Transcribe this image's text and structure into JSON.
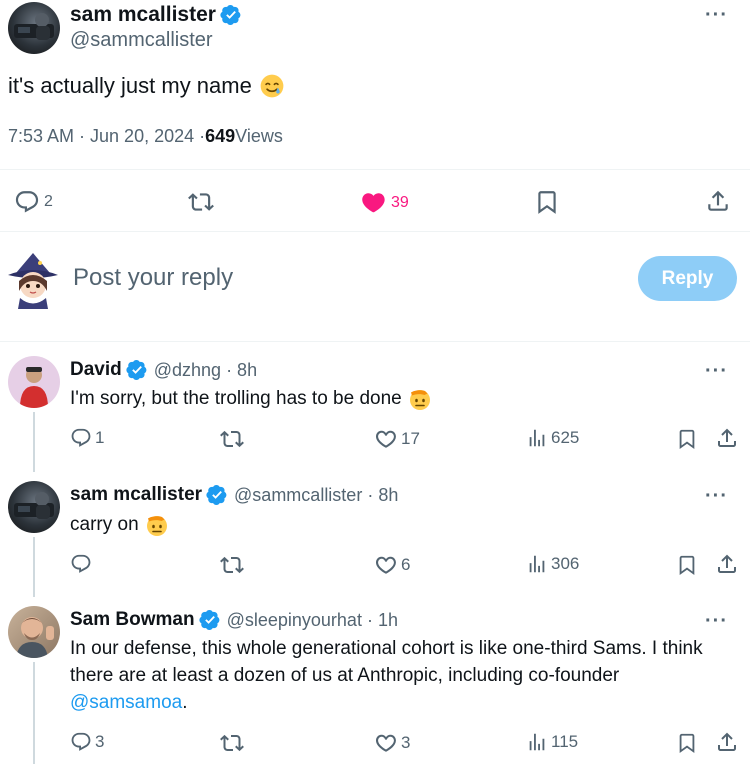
{
  "main_tweet": {
    "author_name": "sam mcallister",
    "author_handle": "@sammcallister",
    "text": "it's actually just my name",
    "time": "7:53 AM · Jun 20, 2024 · ",
    "views_count": "649",
    "views_label": " Views",
    "replies": "2",
    "likes": "39"
  },
  "compose": {
    "placeholder": "Post your reply",
    "button_label": "Reply"
  },
  "replies": [
    {
      "name": "David",
      "handle": "@dzhng · 8h",
      "text": "I'm sorry, but the trolling has to be done",
      "replies": "1",
      "likes": "17",
      "views": "625"
    },
    {
      "name": "sam mcallister",
      "handle": "@sammcallister · 8h",
      "text": "carry on",
      "replies": "",
      "likes": "6",
      "views": "306"
    },
    {
      "name": "Sam Bowman",
      "handle": "@sleepinyourhat · 1h",
      "text_line1": "In our defense, this whole generational cohort is like one-third Sams. I think",
      "text_line2": "there are at least a dozen of us at Anthropic, including co-founder",
      "mention": "@samsamoa",
      "after_mention": ".",
      "replies": "3",
      "likes": "3",
      "views": "115"
    }
  ],
  "colors": {
    "verified": "#1d9bf0",
    "like_active": "#f91880",
    "reply_button": "#8ecdf7"
  },
  "icons": [
    "verified-badge-icon",
    "more-icon",
    "reply-icon",
    "retweet-icon",
    "heart-icon",
    "bookmark-icon",
    "share-icon",
    "views-icon",
    "salute-emoji-icon",
    "tear-smile-emoji-icon"
  ]
}
